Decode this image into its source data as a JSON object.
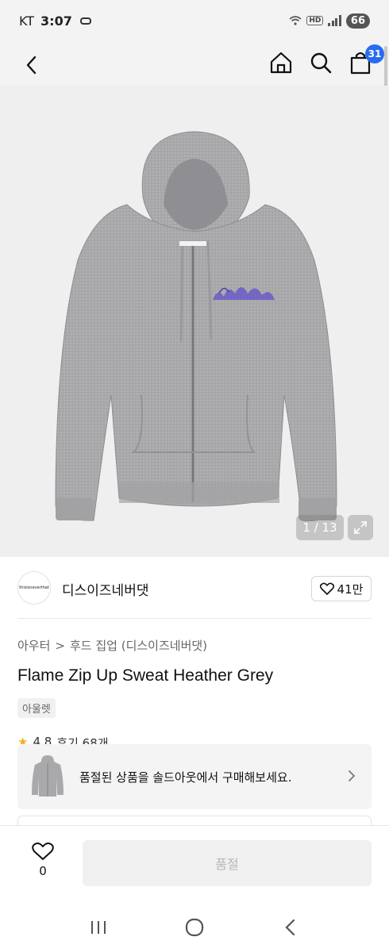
{
  "status_bar": {
    "carrier": "KT",
    "time": "3:07",
    "hd_label": "HD",
    "battery": "66"
  },
  "top_nav": {
    "cart_count": "31"
  },
  "gallery": {
    "counter": "1 / 13"
  },
  "brand": {
    "logo_text": "thisisneverthat",
    "name": "디스이즈네버댓",
    "likes": "41만"
  },
  "breadcrumb": {
    "level1": "아우터",
    "separator": ">",
    "level2": "후드 집업 (디스이즈네버댓)"
  },
  "product": {
    "title": "Flame Zip Up Sweat Heather Grey",
    "badge": "아울렛",
    "rating": "4.8",
    "reviews": "후기 68개"
  },
  "soldout_banner": {
    "text": "품절된 상품을 솔드아웃에서 구매해보세요."
  },
  "bottom_bar": {
    "wish_count": "0",
    "buy_label": "품절"
  },
  "colors": {
    "accent": "#2a6cf0",
    "hoodie": "#a7a7a9",
    "print": "#6a5bc8"
  }
}
